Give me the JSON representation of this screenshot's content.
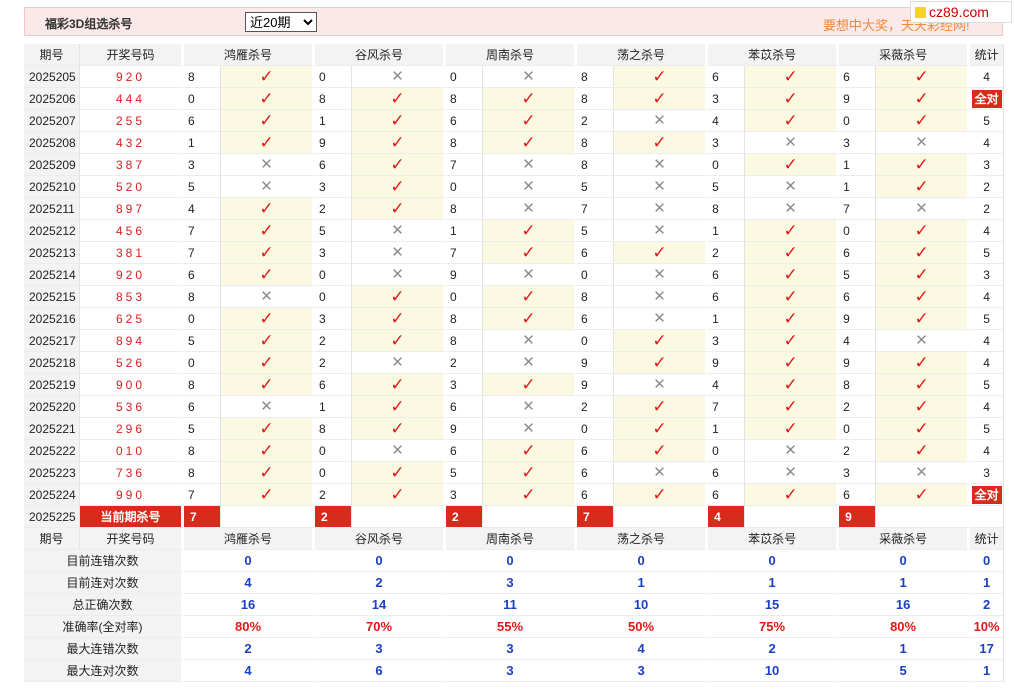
{
  "header": {
    "title": "福彩3D组选杀号",
    "select_value": "近20期",
    "select_options": [
      "近20期"
    ],
    "slogan": "要想中大奖，天天彩经网!",
    "logo_text": "cz89.com"
  },
  "table": {
    "columns": [
      "期号",
      "开奖号码",
      "鸿雁杀号",
      "谷风杀号",
      "周南杀号",
      "荡之杀号",
      "苯苡杀号",
      "采薇杀号",
      "统计"
    ],
    "rows": [
      {
        "period": "2025205",
        "draw": "920",
        "kills": [
          [
            "8",
            1
          ],
          [
            "0",
            0
          ],
          [
            "0",
            0
          ],
          [
            "8",
            1
          ],
          [
            "6",
            1
          ],
          [
            "6",
            1
          ]
        ],
        "stat": "4"
      },
      {
        "period": "2025206",
        "draw": "444",
        "kills": [
          [
            "0",
            1
          ],
          [
            "8",
            1
          ],
          [
            "8",
            1
          ],
          [
            "8",
            1
          ],
          [
            "3",
            1
          ],
          [
            "9",
            1
          ]
        ],
        "stat": "全对"
      },
      {
        "period": "2025207",
        "draw": "255",
        "kills": [
          [
            "6",
            1
          ],
          [
            "1",
            1
          ],
          [
            "6",
            1
          ],
          [
            "2",
            0
          ],
          [
            "4",
            1
          ],
          [
            "0",
            1
          ]
        ],
        "stat": "5"
      },
      {
        "period": "2025208",
        "draw": "432",
        "kills": [
          [
            "1",
            1
          ],
          [
            "9",
            1
          ],
          [
            "8",
            1
          ],
          [
            "8",
            1
          ],
          [
            "3",
            0
          ],
          [
            "3",
            0
          ]
        ],
        "stat": "4"
      },
      {
        "period": "2025209",
        "draw": "387",
        "kills": [
          [
            "3",
            0
          ],
          [
            "6",
            1
          ],
          [
            "7",
            0
          ],
          [
            "8",
            0
          ],
          [
            "0",
            1
          ],
          [
            "1",
            1
          ]
        ],
        "stat": "3"
      },
      {
        "period": "2025210",
        "draw": "520",
        "kills": [
          [
            "5",
            0
          ],
          [
            "3",
            1
          ],
          [
            "0",
            0
          ],
          [
            "5",
            0
          ],
          [
            "5",
            0
          ],
          [
            "1",
            1
          ]
        ],
        "stat": "2"
      },
      {
        "period": "2025211",
        "draw": "897",
        "kills": [
          [
            "4",
            1
          ],
          [
            "2",
            1
          ],
          [
            "8",
            0
          ],
          [
            "7",
            0
          ],
          [
            "8",
            0
          ],
          [
            "7",
            0
          ]
        ],
        "stat": "2"
      },
      {
        "period": "2025212",
        "draw": "456",
        "kills": [
          [
            "7",
            1
          ],
          [
            "5",
            0
          ],
          [
            "1",
            1
          ],
          [
            "5",
            0
          ],
          [
            "1",
            1
          ],
          [
            "0",
            1
          ]
        ],
        "stat": "4"
      },
      {
        "period": "2025213",
        "draw": "381",
        "kills": [
          [
            "7",
            1
          ],
          [
            "3",
            0
          ],
          [
            "7",
            1
          ],
          [
            "6",
            1
          ],
          [
            "2",
            1
          ],
          [
            "6",
            1
          ]
        ],
        "stat": "5"
      },
      {
        "period": "2025214",
        "draw": "920",
        "kills": [
          [
            "6",
            1
          ],
          [
            "0",
            0
          ],
          [
            "9",
            0
          ],
          [
            "0",
            0
          ],
          [
            "6",
            1
          ],
          [
            "5",
            1
          ]
        ],
        "stat": "3"
      },
      {
        "period": "2025215",
        "draw": "853",
        "kills": [
          [
            "8",
            0
          ],
          [
            "0",
            1
          ],
          [
            "0",
            1
          ],
          [
            "8",
            0
          ],
          [
            "6",
            1
          ],
          [
            "6",
            1
          ]
        ],
        "stat": "4"
      },
      {
        "period": "2025216",
        "draw": "625",
        "kills": [
          [
            "0",
            1
          ],
          [
            "3",
            1
          ],
          [
            "8",
            1
          ],
          [
            "6",
            0
          ],
          [
            "1",
            1
          ],
          [
            "9",
            1
          ]
        ],
        "stat": "5"
      },
      {
        "period": "2025217",
        "draw": "894",
        "kills": [
          [
            "5",
            1
          ],
          [
            "2",
            1
          ],
          [
            "8",
            0
          ],
          [
            "0",
            1
          ],
          [
            "3",
            1
          ],
          [
            "4",
            0
          ]
        ],
        "stat": "4"
      },
      {
        "period": "2025218",
        "draw": "526",
        "kills": [
          [
            "0",
            1
          ],
          [
            "2",
            0
          ],
          [
            "2",
            0
          ],
          [
            "9",
            1
          ],
          [
            "9",
            1
          ],
          [
            "9",
            1
          ]
        ],
        "stat": "4"
      },
      {
        "period": "2025219",
        "draw": "900",
        "kills": [
          [
            "8",
            1
          ],
          [
            "6",
            1
          ],
          [
            "3",
            1
          ],
          [
            "9",
            0
          ],
          [
            "4",
            1
          ],
          [
            "8",
            1
          ]
        ],
        "stat": "5"
      },
      {
        "period": "2025220",
        "draw": "536",
        "kills": [
          [
            "6",
            0
          ],
          [
            "1",
            1
          ],
          [
            "6",
            0
          ],
          [
            "2",
            1
          ],
          [
            "7",
            1
          ],
          [
            "2",
            1
          ]
        ],
        "stat": "4"
      },
      {
        "period": "2025221",
        "draw": "296",
        "kills": [
          [
            "5",
            1
          ],
          [
            "8",
            1
          ],
          [
            "9",
            0
          ],
          [
            "0",
            1
          ],
          [
            "1",
            1
          ],
          [
            "0",
            1
          ]
        ],
        "stat": "5"
      },
      {
        "period": "2025222",
        "draw": "010",
        "kills": [
          [
            "8",
            1
          ],
          [
            "0",
            0
          ],
          [
            "6",
            1
          ],
          [
            "6",
            1
          ],
          [
            "0",
            0
          ],
          [
            "2",
            1
          ]
        ],
        "stat": "4"
      },
      {
        "period": "2025223",
        "draw": "736",
        "kills": [
          [
            "8",
            1
          ],
          [
            "0",
            1
          ],
          [
            "5",
            1
          ],
          [
            "6",
            0
          ],
          [
            "6",
            0
          ],
          [
            "3",
            0
          ]
        ],
        "stat": "3"
      },
      {
        "period": "2025224",
        "draw": "990",
        "kills": [
          [
            "7",
            1
          ],
          [
            "2",
            1
          ],
          [
            "3",
            1
          ],
          [
            "6",
            1
          ],
          [
            "6",
            1
          ],
          [
            "6",
            1
          ]
        ],
        "stat": "全对"
      }
    ],
    "current": {
      "period": "2025225",
      "label": "当前期杀号",
      "kills": [
        "7",
        "2",
        "2",
        "7",
        "4",
        "9"
      ]
    },
    "summary": [
      {
        "label": "目前连错次数",
        "values": [
          "0",
          "0",
          "0",
          "0",
          "0",
          "0",
          "0"
        ],
        "red": false
      },
      {
        "label": "目前连对次数",
        "values": [
          "4",
          "2",
          "3",
          "1",
          "1",
          "1",
          "1"
        ],
        "red": false
      },
      {
        "label": "总正确次数",
        "values": [
          "16",
          "14",
          "11",
          "10",
          "15",
          "16",
          "2"
        ],
        "red": false
      },
      {
        "label": "准确率(全对率)",
        "values": [
          "80%",
          "70%",
          "55%",
          "50%",
          "75%",
          "80%",
          "10%"
        ],
        "red": true
      },
      {
        "label": "最大连错次数",
        "values": [
          "2",
          "3",
          "3",
          "4",
          "2",
          "1",
          "17"
        ],
        "red": false
      },
      {
        "label": "最大连对次数",
        "values": [
          "4",
          "6",
          "3",
          "3",
          "10",
          "5",
          "1"
        ],
        "red": false
      }
    ]
  },
  "icons": {
    "correct": "check-icon",
    "wrong": "cross-icon"
  },
  "colors": {
    "accent_red": "#d82b1c",
    "value_blue": "#1d3fc2",
    "mark_bg": "#fbf9e2",
    "header_bg": "#fbe8e8"
  }
}
